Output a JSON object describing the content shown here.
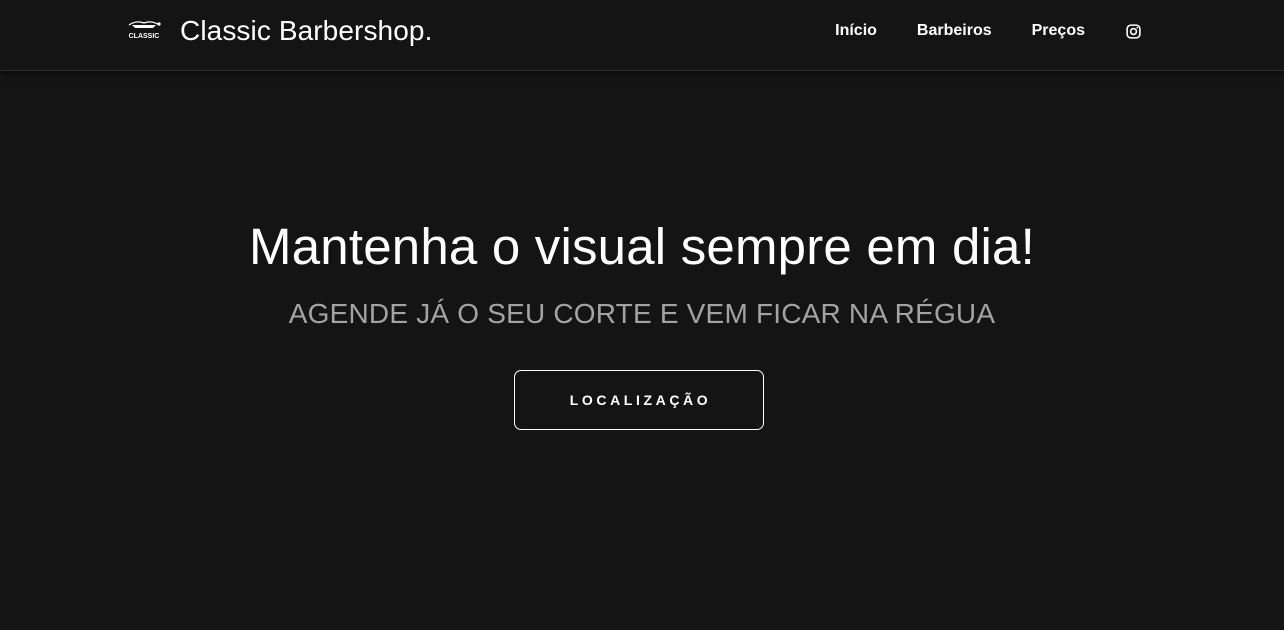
{
  "header": {
    "logo_icon": "classic-barbershop-logo",
    "logo_text": "CLASSIC",
    "brand": "Classic Barbershop.",
    "nav": [
      {
        "label": "Início"
      },
      {
        "label": "Barbeiros"
      },
      {
        "label": "Preços"
      }
    ],
    "social_icon": "instagram-icon"
  },
  "hero": {
    "title": "Mantenha o visual sempre em dia!",
    "subtitle": "AGENDE JÁ O SEU CORTE E VEM FICAR NA RÉGUA",
    "button_label": "LOCALIZAÇÃO"
  },
  "colors": {
    "background": "#141414",
    "text": "#ffffff",
    "subtitle": "#a3a3a3"
  }
}
